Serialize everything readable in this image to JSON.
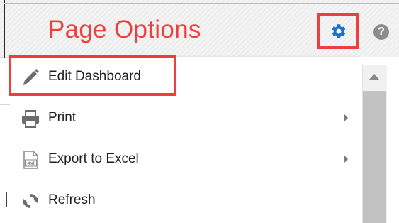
{
  "header": {
    "title": "Page Options",
    "gear_icon": "gear-icon",
    "help_icon": "help-icon",
    "help_glyph": "?"
  },
  "menu": {
    "items": [
      {
        "label": "Edit Dashboard",
        "icon": "pencil-icon",
        "has_submenu": false
      },
      {
        "label": "Print",
        "icon": "printer-icon",
        "has_submenu": true
      },
      {
        "label": "Export to Excel",
        "icon": "excel-file-icon",
        "has_submenu": true
      },
      {
        "label": "Refresh",
        "icon": "refresh-icon",
        "has_submenu": false
      }
    ]
  },
  "colors": {
    "highlight": "#ee3f3f",
    "gear": "#1a6fd1",
    "icon_gray": "#6d6d6d"
  }
}
